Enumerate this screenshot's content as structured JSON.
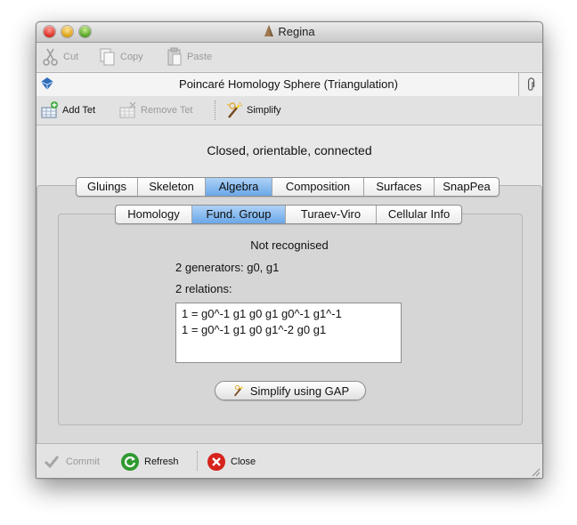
{
  "window": {
    "title": "Regina"
  },
  "edit_toolbar": {
    "cut": "Cut",
    "copy": "Copy",
    "paste": "Paste"
  },
  "packet": {
    "title": "Poincaré Homology Sphere (Triangulation)"
  },
  "tri_toolbar": {
    "add_tet": "Add Tet",
    "remove_tet": "Remove Tet",
    "simplify": "Simplify"
  },
  "header": {
    "status": "Closed, orientable, connected"
  },
  "tabs": [
    "Gluings",
    "Skeleton",
    "Algebra",
    "Composition",
    "Surfaces",
    "SnapPea"
  ],
  "subtabs": [
    "Homology",
    "Fund. Group",
    "Turaev-Viro",
    "Cellular Info"
  ],
  "fund_group": {
    "recognition": "Not recognised",
    "generators": "2 generators: g0, g1",
    "relations_label": "2 relations:",
    "relations": [
      "1 = g0^-1 g1 g0 g1 g0^-1 g1^-1",
      "1 = g0^-1 g1 g0 g1^-2 g0 g1"
    ],
    "simplify_button": "Simplify using GAP"
  },
  "bottom": {
    "commit": "Commit",
    "refresh": "Refresh",
    "close": "Close"
  },
  "colors": {
    "active_tab": "#7fb4ec",
    "close_red": "#d6231b",
    "refresh_green": "#2f9a2f"
  }
}
